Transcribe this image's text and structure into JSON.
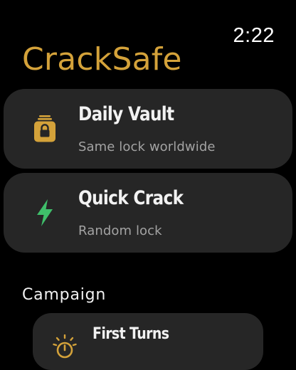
{
  "status": {
    "time": "2:22"
  },
  "app": {
    "title": "CrackSafe",
    "accent_color": "#d4a23a"
  },
  "modes": [
    {
      "title": "Daily Vault",
      "subtitle": "Same lock worldwide",
      "icon": "padlock-icon",
      "icon_color": "#d4a23a"
    },
    {
      "title": "Quick Crack",
      "subtitle": "Random lock",
      "icon": "lightning-icon",
      "icon_color": "#3fbf6a"
    }
  ],
  "campaign": {
    "section_title": "Campaign",
    "levels": [
      {
        "title": "First Turns",
        "icon": "timer-icon",
        "icon_color": "#d4a23a"
      }
    ]
  }
}
